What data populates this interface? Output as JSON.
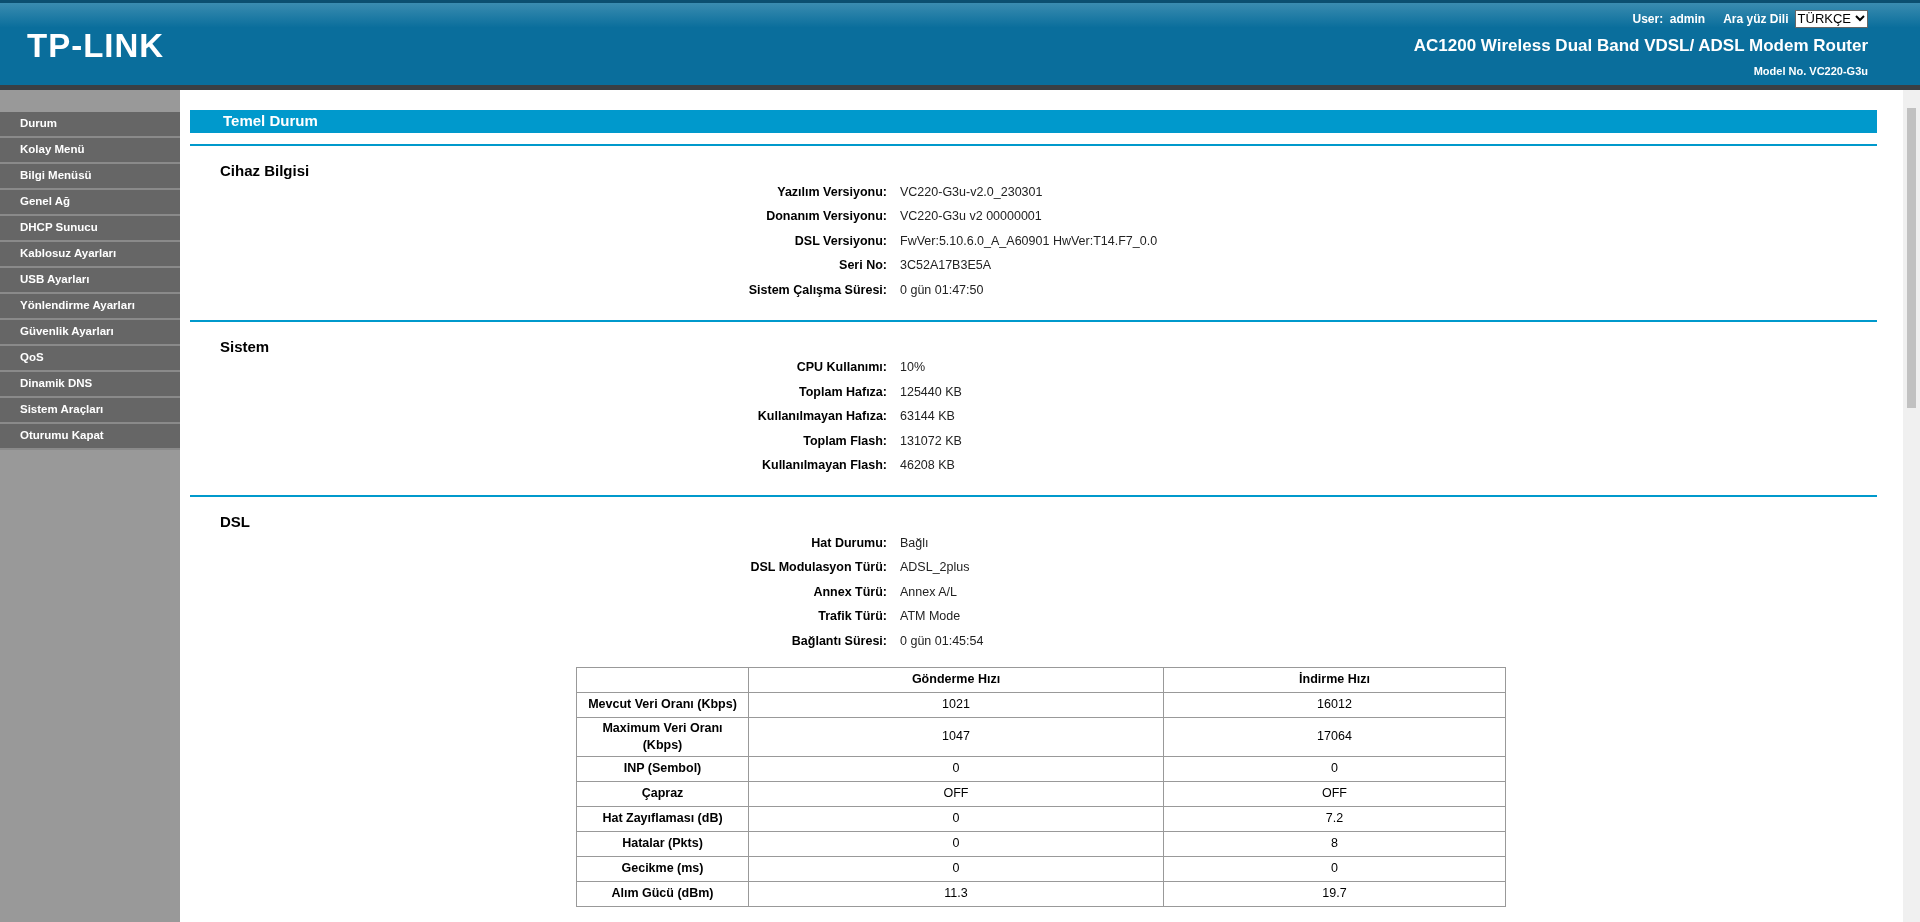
{
  "header": {
    "logo": "TP-LINK",
    "user_label": "User:",
    "user": "admin",
    "language_label": "Ara yüz Dili",
    "language": "TÜRKÇE",
    "product": "AC1200 Wireless Dual Band VDSL/ ADSL Modem Router",
    "model": "Model No. VC220-G3u"
  },
  "sidebar": {
    "items": [
      "Durum",
      "Kolay Menü",
      "Bilgi Menüsü",
      "Genel Ağ",
      "DHCP Sunucu",
      "Kablosuz Ayarları",
      "USB Ayarları",
      "Yönlendirme Ayarları",
      "Güvenlik Ayarları",
      "QoS",
      "Dinamik DNS",
      "Sistem Araçları",
      "Oturumu Kapat"
    ]
  },
  "page_title": "Temel Durum",
  "sections": [
    {
      "title": "Cihaz Bilgisi",
      "rows": [
        {
          "label": "Yazılım Versiyonu:",
          "value": "VC220-G3u-v2.0_230301"
        },
        {
          "label": "Donanım Versiyonu:",
          "value": "VC220-G3u v2 00000001"
        },
        {
          "label": "DSL Versiyonu:",
          "value": "FwVer:5.10.6.0_A_A60901 HwVer:T14.F7_0.0"
        },
        {
          "label": "Seri No:",
          "value": "3C52A17B3E5A"
        },
        {
          "label": "Sistem Çalışma Süresi:",
          "value": "0 gün 01:47:50"
        }
      ]
    },
    {
      "title": "Sistem",
      "rows": [
        {
          "label": "CPU Kullanımı:",
          "value": "10%"
        },
        {
          "label": "Toplam Hafıza:",
          "value": "125440 KB"
        },
        {
          "label": "Kullanılmayan Hafıza:",
          "value": "63144 KB"
        },
        {
          "label": "Toplam Flash:",
          "value": "131072 KB"
        },
        {
          "label": "Kullanılmayan Flash:",
          "value": "46208 KB"
        }
      ]
    },
    {
      "title": "DSL",
      "rows": [
        {
          "label": "Hat Durumu:",
          "value": "Bağlı"
        },
        {
          "label": "DSL Modulasyon Türü:",
          "value": "ADSL_2plus"
        },
        {
          "label": "Annex Türü:",
          "value": "Annex A/L"
        },
        {
          "label": "Trafik Türü:",
          "value": "ATM Mode"
        },
        {
          "label": "Bağlantı Süresi:",
          "value": "0 gün 01:45:54"
        }
      ],
      "table": {
        "columns": [
          "Gönderme Hızı",
          "İndirme Hızı"
        ],
        "rows": [
          {
            "label": "Mevcut Veri Oranı (Kbps)",
            "values": [
              "1021",
              "16012"
            ]
          },
          {
            "label": "Maximum Veri Oranı (Kbps)",
            "values": [
              "1047",
              "17064"
            ]
          },
          {
            "label": "INP (Sembol)",
            "values": [
              "0",
              "0"
            ]
          },
          {
            "label": "Çapraz",
            "values": [
              "OFF",
              "OFF"
            ]
          },
          {
            "label": "Hat Zayıflaması (dB)",
            "values": [
              "0",
              "7.2"
            ]
          },
          {
            "label": "Hatalar (Pkts)",
            "values": [
              "0",
              "8"
            ]
          },
          {
            "label": "Gecikme (ms)",
            "values": [
              "0",
              "0"
            ]
          },
          {
            "label": "Alım Gücü (dBm)",
            "values": [
              "11.3",
              "19.7"
            ]
          }
        ]
      }
    }
  ]
}
